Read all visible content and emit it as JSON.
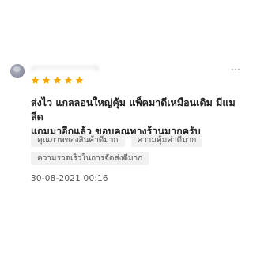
{
  "review": {
    "username": "a*******************8",
    "rating": 5,
    "rating_max": 5,
    "star_color": "#F6A700",
    "text_line1": "ส่งไว แกลลอนใหญ่คุ้ม แพ็คมาดีเหมือนเดิม มีแมลีด",
    "text_line2": "แถมมาอีกแล้ว ขอบคุณทางร้านมากครับ",
    "tags": [
      "คุณภาพของสินค้าดีมาก",
      "ความคุ้มค่าดีมาก",
      "ความรวดเร็วในการจัดส่งดีมาก"
    ],
    "timestamp": "30-08-2021 00:16"
  },
  "icons": {
    "avatar": "user-avatar",
    "more": "more-options-icon",
    "star": "star-icon"
  }
}
